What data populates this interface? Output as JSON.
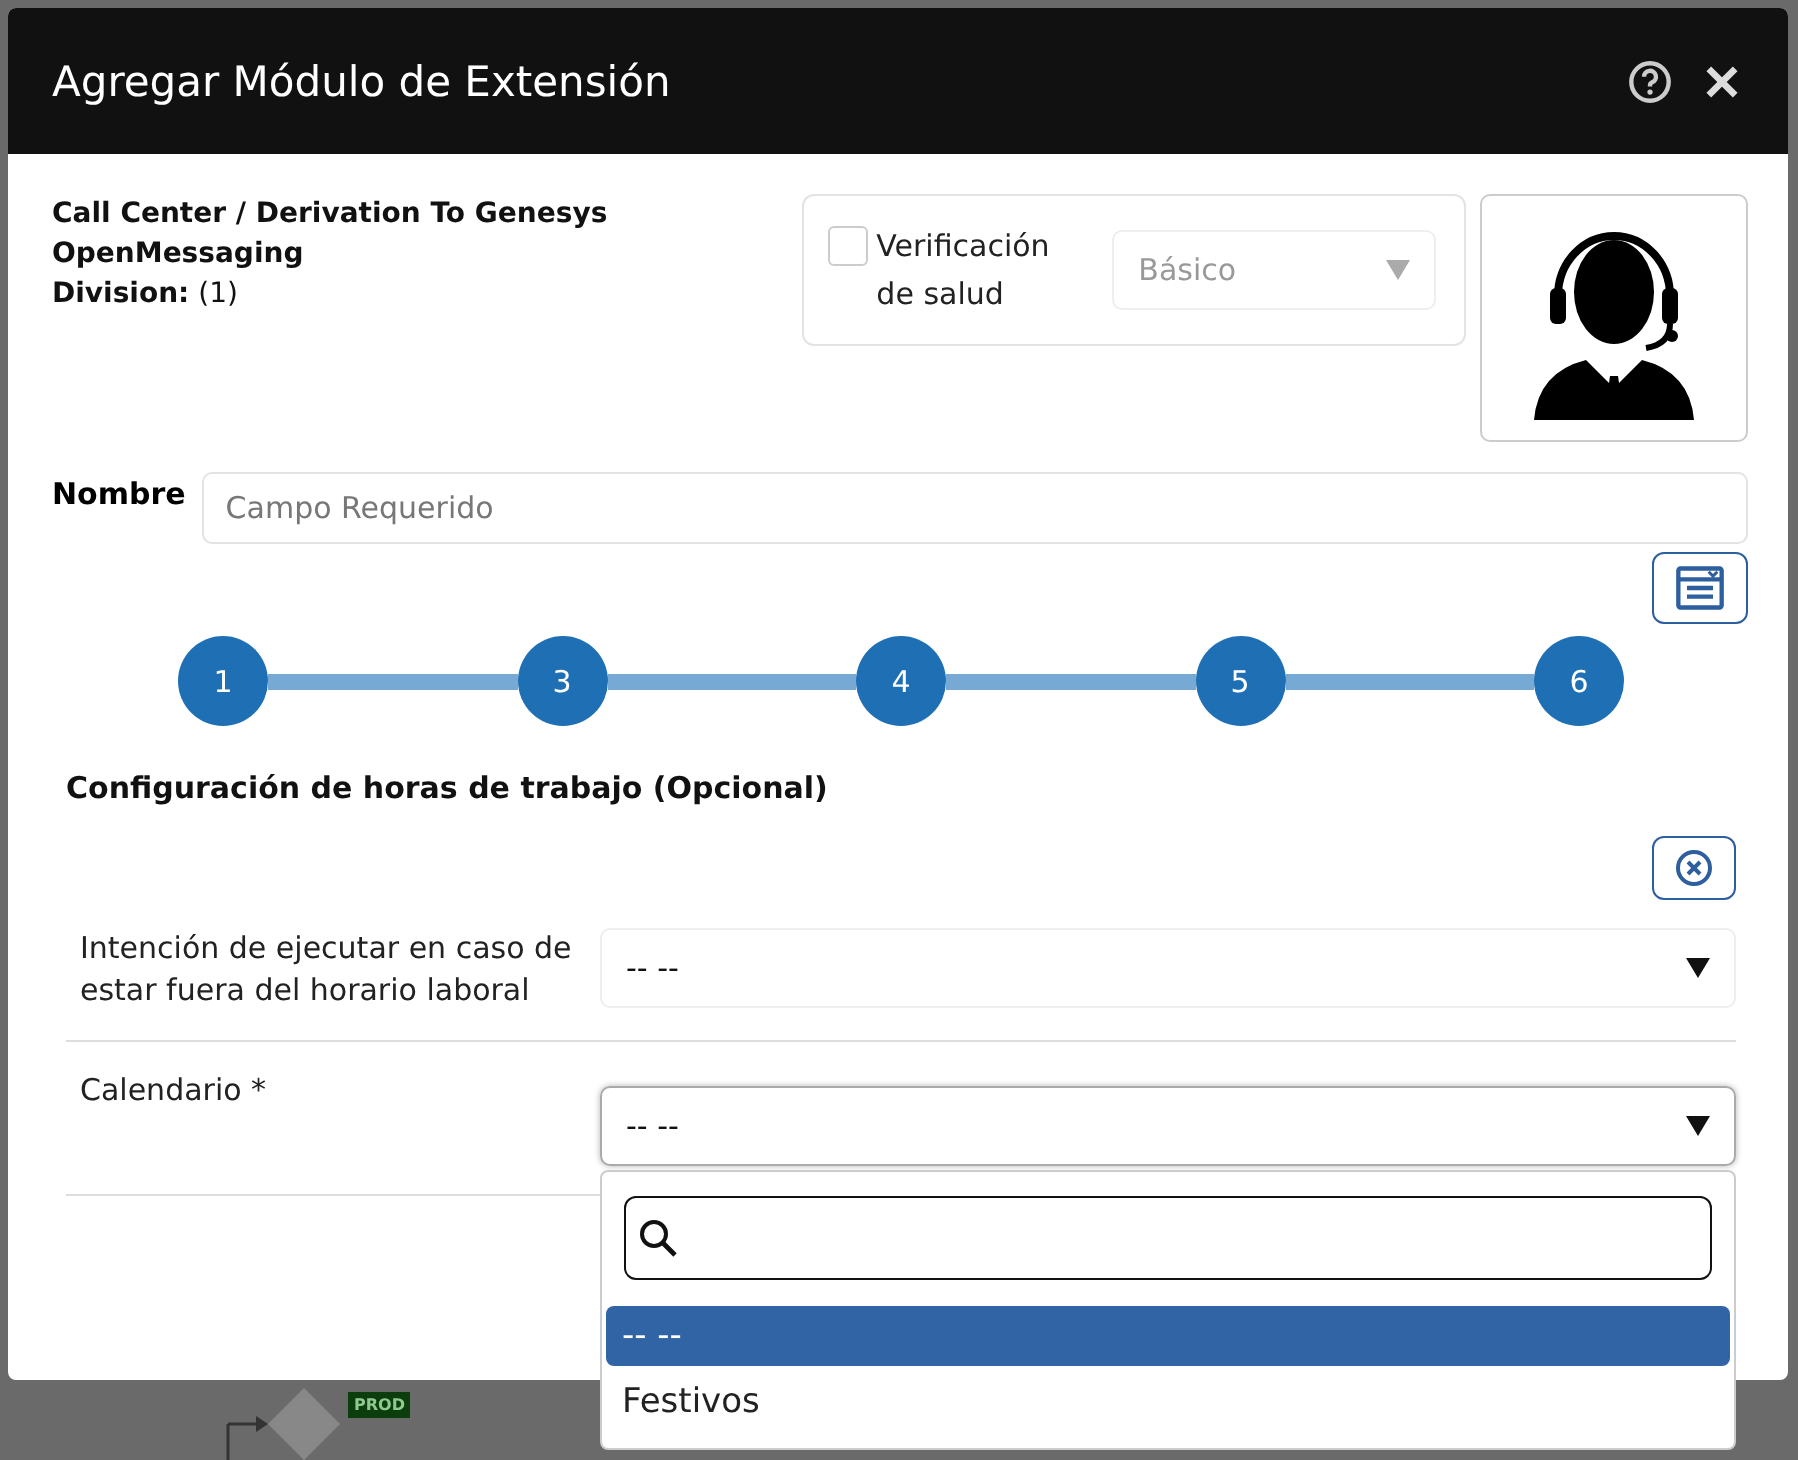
{
  "background": {
    "badge": "PROD"
  },
  "dialog": {
    "title": "Agregar Módulo de Extensión"
  },
  "module": {
    "name": "Call Center / Derivation To Genesys OpenMessaging",
    "division_label": "Division:",
    "division_value": "(1)"
  },
  "health_check": {
    "label": "Verificación de salud",
    "checked": false,
    "level_select": {
      "value": "Básico",
      "disabled": true
    }
  },
  "name_field": {
    "label": "Nombre",
    "placeholder": "Campo Requerido"
  },
  "steps": [
    {
      "label": "1"
    },
    {
      "label": "3"
    },
    {
      "label": "4"
    },
    {
      "label": "5"
    },
    {
      "label": "6"
    }
  ],
  "section_title": "Configuración de horas de trabajo (Opcional)",
  "fields": [
    {
      "label": "Intención de ejecutar en caso de estar fuera del horario laboral",
      "value": "-- --",
      "open": false
    },
    {
      "label": "Calendario *",
      "value": "-- --",
      "open": true
    }
  ],
  "dropdown": {
    "options": [
      {
        "label": "-- --",
        "selected": true
      },
      {
        "label": "Festivos",
        "selected": false
      }
    ]
  }
}
